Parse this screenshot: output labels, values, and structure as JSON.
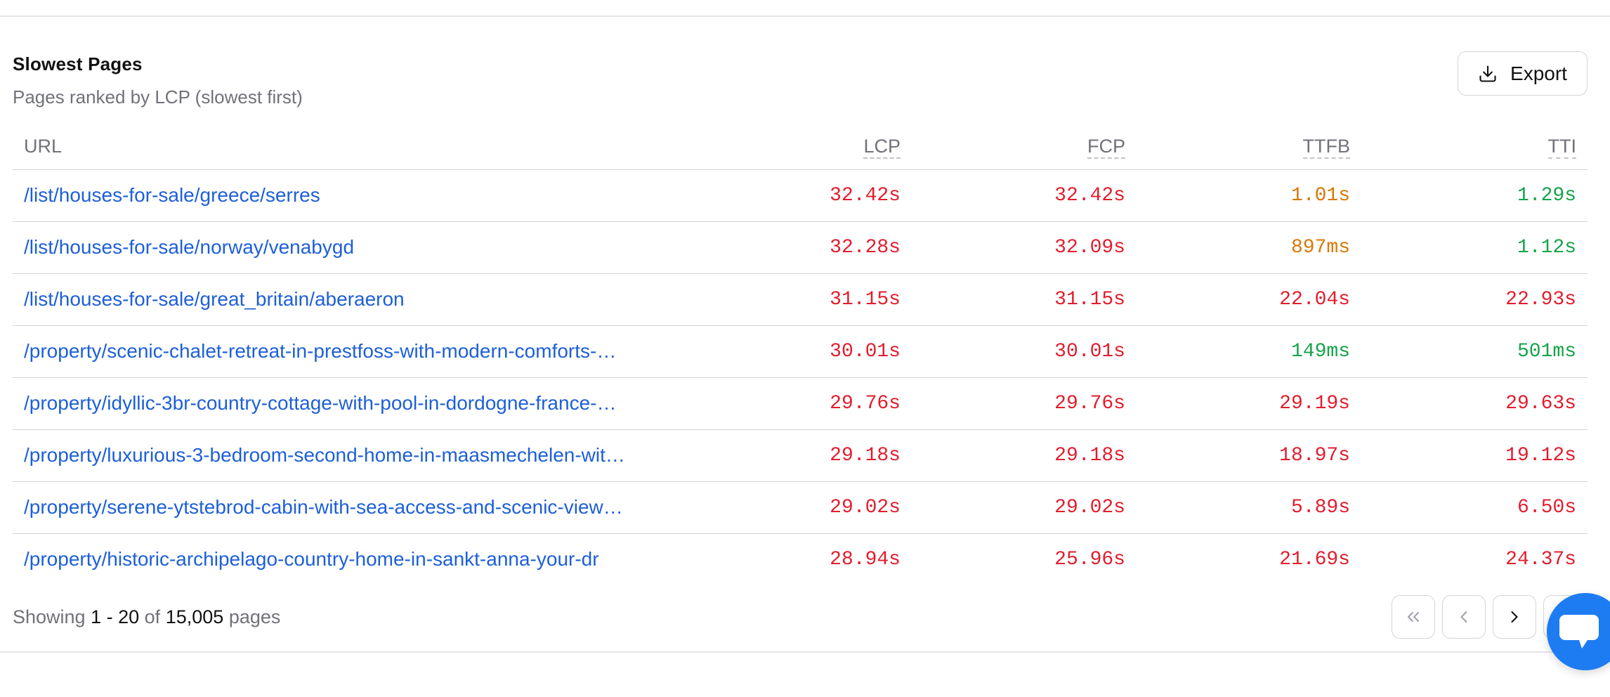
{
  "header": {
    "title": "Slowest Pages",
    "subtitle": "Pages ranked by LCP (slowest first)",
    "export_label": "Export"
  },
  "table": {
    "columns": [
      "URL",
      "LCP",
      "FCP",
      "TTFB",
      "TTI"
    ],
    "rows": [
      {
        "url": "/list/houses-for-sale/greece/serres",
        "lcp": "32.42s",
        "fcp": "32.42s",
        "ttfb": "1.01s",
        "tti": "1.29s"
      },
      {
        "url": "/list/houses-for-sale/norway/venabygd",
        "lcp": "32.28s",
        "fcp": "32.09s",
        "ttfb": "897ms",
        "tti": "1.12s"
      },
      {
        "url": "/list/houses-for-sale/great_britain/aberaeron",
        "lcp": "31.15s",
        "fcp": "31.15s",
        "ttfb": "22.04s",
        "tti": "22.93s"
      },
      {
        "url": "/property/scenic-chalet-retreat-in-prestfoss-with-modern-comforts-…",
        "lcp": "30.01s",
        "fcp": "30.01s",
        "ttfb": "149ms",
        "tti": "501ms"
      },
      {
        "url": "/property/idyllic-3br-country-cottage-with-pool-in-dordogne-france-…",
        "lcp": "29.76s",
        "fcp": "29.76s",
        "ttfb": "29.19s",
        "tti": "29.63s"
      },
      {
        "url": "/property/luxurious-3-bedroom-second-home-in-maasmechelen-wit…",
        "lcp": "29.18s",
        "fcp": "29.18s",
        "ttfb": "18.97s",
        "tti": "19.12s"
      },
      {
        "url": "/property/serene-ytstebrod-cabin-with-sea-access-and-scenic-view…",
        "lcp": "29.02s",
        "fcp": "29.02s",
        "ttfb": "5.89s",
        "tti": "6.50s"
      },
      {
        "url": "/property/historic-archipelago-country-home-in-sankt-anna-your-dr",
        "lcp": "28.94s",
        "fcp": "25.96s",
        "ttfb": "21.69s",
        "tti": "24.37s"
      }
    ]
  },
  "footer": {
    "showing_prefix": "Showing",
    "range": "1 - 20",
    "of_label": "of",
    "total": "15,005",
    "unit": "pages"
  },
  "colors": {
    "link": "#1d5fd8",
    "poor": "#e11d2e",
    "needs_improvement": "#d97706",
    "good": "#16a34a",
    "chat_fab": "#1d7cf2"
  },
  "icons": {
    "export": "download-icon",
    "first": "chevrons-left-icon",
    "prev": "chevron-left-icon",
    "next": "chevron-right-icon",
    "last": "chevrons-right-icon",
    "chat": "chat-icon"
  }
}
